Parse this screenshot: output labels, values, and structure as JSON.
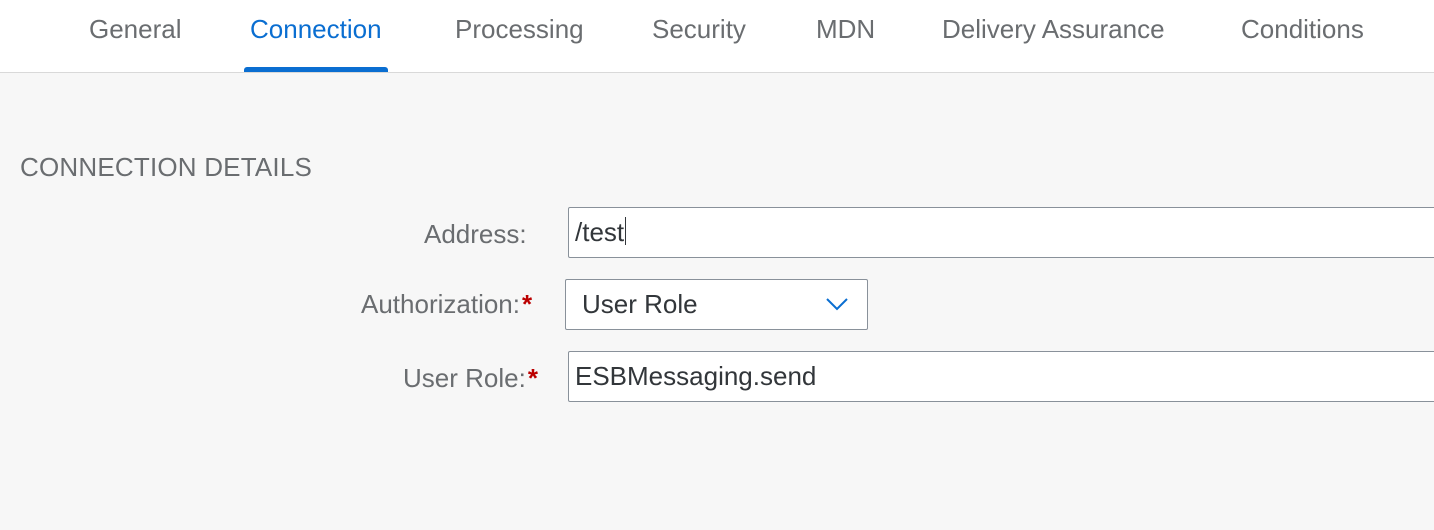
{
  "tabs": [
    {
      "label": "General",
      "active": false
    },
    {
      "label": "Connection",
      "active": true
    },
    {
      "label": "Processing",
      "active": false
    },
    {
      "label": "Security",
      "active": false
    },
    {
      "label": "MDN",
      "active": false
    },
    {
      "label": "Delivery Assurance",
      "active": false
    },
    {
      "label": "Conditions",
      "active": false
    }
  ],
  "section": {
    "title": "CONNECTION DETAILS"
  },
  "form": {
    "address": {
      "label": "Address:",
      "value": "/test"
    },
    "authorization": {
      "label": "Authorization:",
      "required_mark": "*",
      "value": "User Role",
      "icon": "chevron-down-icon"
    },
    "user_role": {
      "label": "User Role:",
      "required_mark": "*",
      "value": "ESBMessaging.send"
    }
  },
  "colors": {
    "accent": "#0a6ed1",
    "required": "#bb0000",
    "label": "#6a6d70",
    "text": "#32363a",
    "background": "#f7f7f7"
  }
}
